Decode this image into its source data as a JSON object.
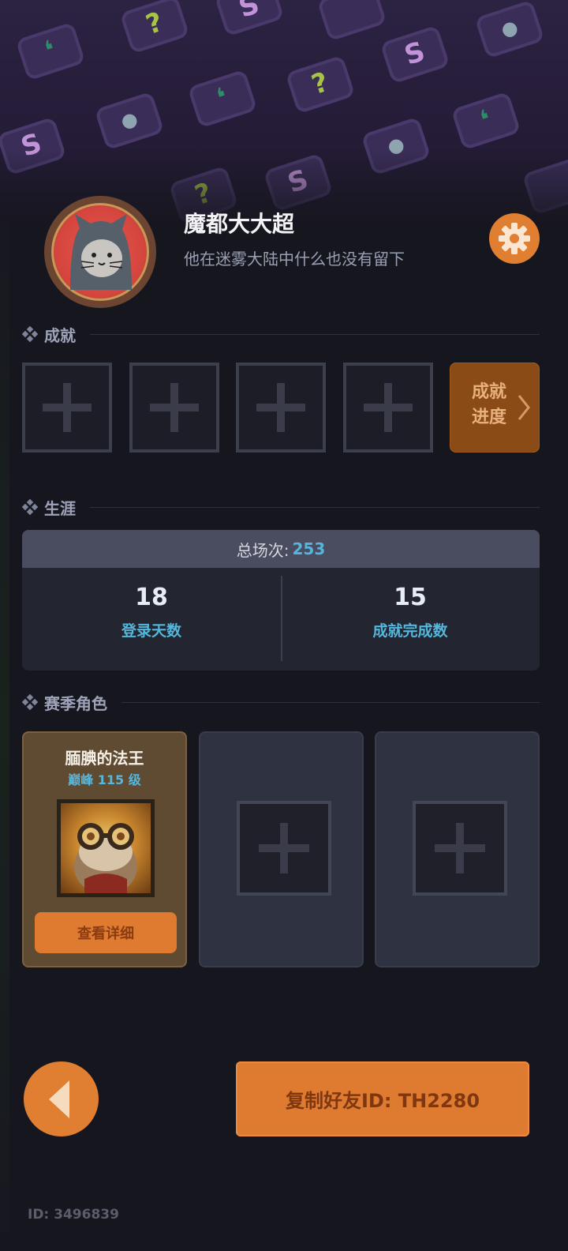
{
  "profile": {
    "nickname": "魔都大大超",
    "signature": "他在迷雾大陆中什么也没有留下",
    "avatar_icon": "hooded-cat-icon",
    "settings_icon": "gear-icon"
  },
  "achievements": {
    "title": "成就",
    "slots": [
      "empty",
      "empty",
      "empty",
      "empty"
    ],
    "progress_label": "成就进度"
  },
  "career": {
    "title": "生涯",
    "total_label": "总场次:",
    "total_value": "253",
    "stats": [
      {
        "value": "18",
        "label": "登录天数"
      },
      {
        "value": "15",
        "label": "成就完成数"
      }
    ]
  },
  "season_roles": {
    "title": "赛季角色",
    "main": {
      "name": "腼腆的法王",
      "level": "巅峰 115 级",
      "detail_button": "查看详细"
    },
    "empty_slots": 2
  },
  "actions": {
    "copy_button": "复制好友ID: TH2280",
    "back_icon": "back-arrow-icon"
  },
  "footer": {
    "id_text": "ID: 3496839"
  },
  "colors": {
    "accent_orange": "#df7a31",
    "stat_blue": "#53b6dc",
    "background": "#16161e"
  }
}
